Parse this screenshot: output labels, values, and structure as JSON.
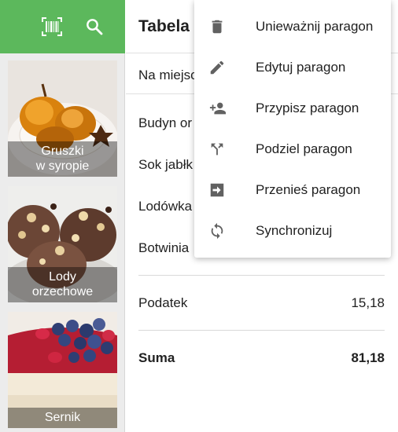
{
  "toolbar": {
    "barcode_icon": "barcode-scan-icon",
    "search_icon": "search-icon",
    "color": "#5cb85c"
  },
  "products": [
    {
      "name_line1": "Gruszki",
      "name_line2": "w syropie"
    },
    {
      "name_line1": "Lody",
      "name_line2": "orzechowe"
    },
    {
      "name_line1": "Sernik",
      "name_line2": ""
    }
  ],
  "order": {
    "title": "Tabela",
    "type_label": "Na miejsc",
    "items": [
      "Budyn or",
      "Sok jabłk",
      "Lodówka",
      "Botwinia"
    ],
    "tax_label": "Podatek",
    "tax_value": "15,18",
    "total_label": "Suma",
    "total_value": "81,18"
  },
  "menu": {
    "items": [
      {
        "label": "Unieważnij paragon",
        "icon": "trash-icon"
      },
      {
        "label": "Edytuj paragon",
        "icon": "pencil-icon"
      },
      {
        "label": "Przypisz paragon",
        "icon": "assign-person-icon"
      },
      {
        "label": "Podziel paragon",
        "icon": "split-icon"
      },
      {
        "label": "Przenieś paragon",
        "icon": "move-receipt-icon"
      },
      {
        "label": "Synchronizuj",
        "icon": "sync-icon"
      }
    ]
  }
}
